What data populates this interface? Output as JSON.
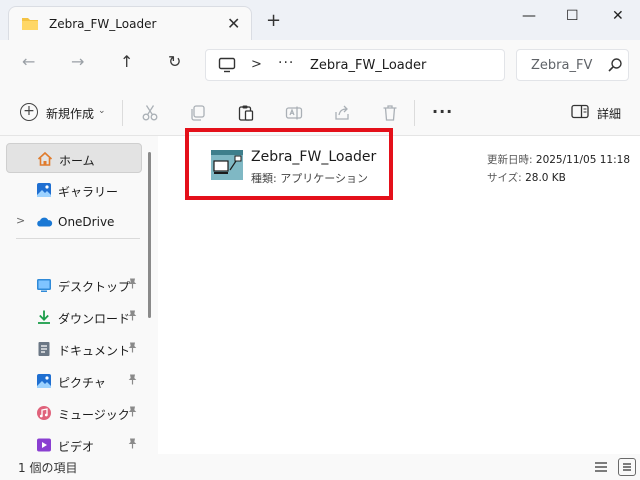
{
  "window": {
    "tab_title": "Zebra_FW_Loader",
    "tab_close": "✕",
    "new_tab": "+",
    "minimize": "—",
    "maximize": "☐",
    "close": "✕"
  },
  "navigation": {
    "back": "←",
    "forward": "→",
    "up": "↑",
    "refresh": "↻",
    "breadcrumb_separator": ">",
    "breadcrumb_overflow": "···",
    "breadcrumb_current": "Zebra_FW_Loader"
  },
  "search": {
    "placeholder": "Zebra_FW_Loader の検索",
    "visible_text": "Zebra_FV"
  },
  "toolbar": {
    "new_label": "新規作成",
    "new_dropdown": "⌄",
    "more": "···",
    "details_label": "詳細"
  },
  "sidebar": {
    "items": [
      {
        "label": "ホーム",
        "icon": "home-icon",
        "selected": true
      },
      {
        "label": "ギャラリー",
        "icon": "gallery-icon"
      },
      {
        "label": "OneDrive",
        "icon": "onedrive-icon",
        "expander": ">"
      }
    ],
    "pinned": [
      {
        "label": "デスクトップ",
        "icon": "desktop-icon"
      },
      {
        "label": "ダウンロード",
        "icon": "download-icon"
      },
      {
        "label": "ドキュメント",
        "icon": "documents-icon"
      },
      {
        "label": "ピクチャ",
        "icon": "pictures-icon"
      },
      {
        "label": "ミュージック",
        "icon": "music-icon"
      },
      {
        "label": "ビデオ",
        "icon": "videos-icon"
      }
    ],
    "pin_glyph": "📌"
  },
  "file": {
    "name": "Zebra_FW_Loader",
    "type_label": "種類: アプリケーション",
    "modified_label": "更新日時:",
    "modified_value": "2025/11/05 11:18",
    "size_label": "サイズ:",
    "size_value": "28.0 KB"
  },
  "status": {
    "item_count": "1 個の項目"
  },
  "colors": {
    "highlight": "#e4101a",
    "accent": "#0067c0",
    "folder": "#f4c344"
  }
}
